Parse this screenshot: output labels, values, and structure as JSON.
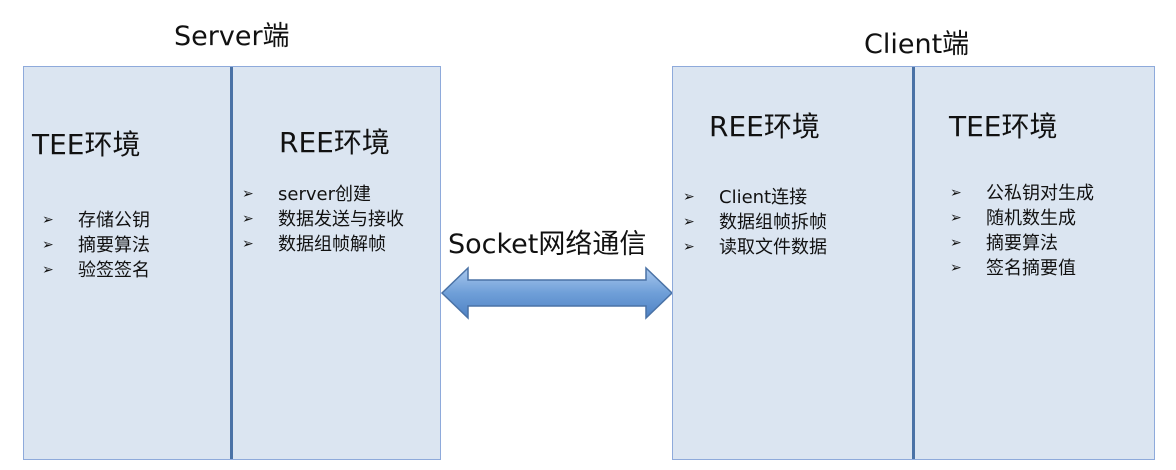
{
  "server": {
    "title": "Server端",
    "tee": {
      "title": "TEE环境",
      "items": [
        "存储公钥",
        "摘要算法",
        "验签签名"
      ]
    },
    "ree": {
      "title": "REE环境",
      "items": [
        "server创建",
        "数据发送与接收",
        "数据组帧解帧"
      ]
    }
  },
  "connection": {
    "label": "Socket网络通信"
  },
  "client": {
    "title": "Client端",
    "ree": {
      "title": "REE环境",
      "items": [
        "Client连接",
        "数据组帧拆帧",
        "读取文件数据"
      ]
    },
    "tee": {
      "title": "TEE环境",
      "items": [
        "公私钥对生成",
        "随机数生成",
        "摘要算法",
        "签名摘要值"
      ]
    }
  },
  "icons": {
    "bullet": "arrowhead-bullet-icon",
    "connection": "double-arrow-icon"
  },
  "colors": {
    "panel_fill": "#dbe5f1",
    "panel_border": "#8eaadb",
    "divider": "#4a72a6",
    "arrow_fill": "#6f9fd8"
  }
}
